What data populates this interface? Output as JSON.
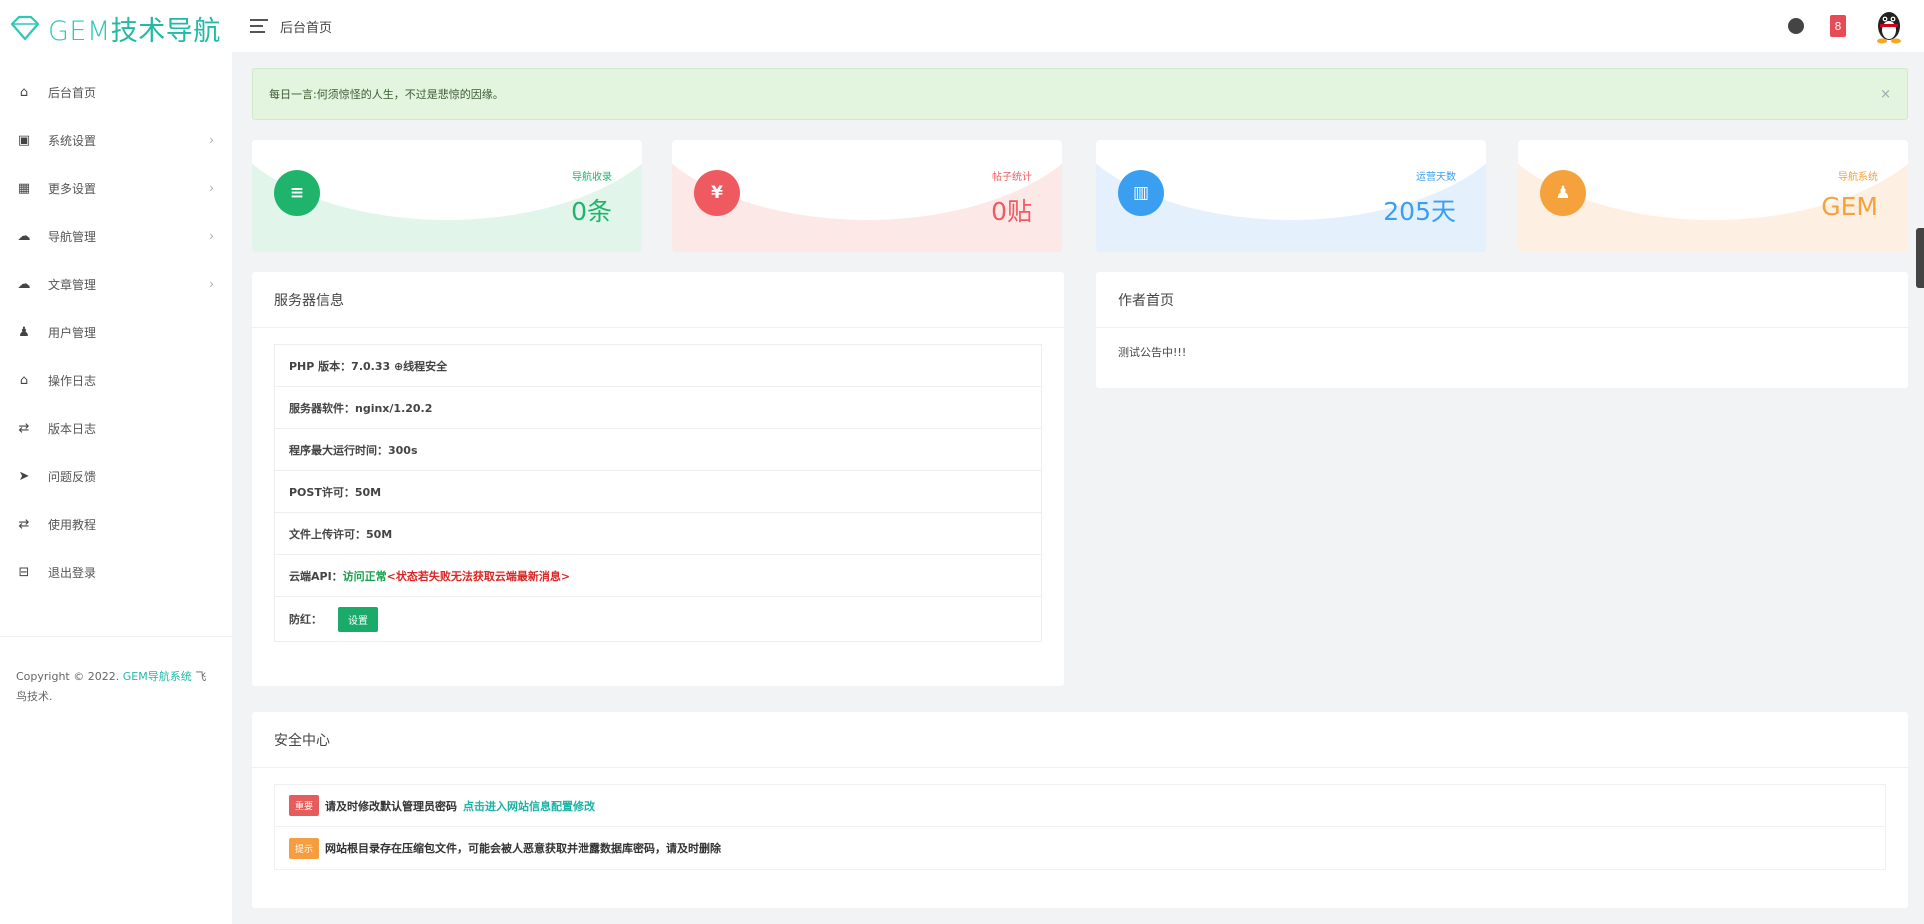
{
  "brand": {
    "prefix": "GEM",
    "suffix": "技术导航"
  },
  "sidebar": {
    "items": [
      {
        "icon": "home-icon",
        "glyph": "⌂",
        "label": "后台首页",
        "has_children": false
      },
      {
        "icon": "settings-icon",
        "glyph": "▣",
        "label": "系统设置",
        "has_children": true
      },
      {
        "icon": "grid-icon",
        "glyph": "▦",
        "label": "更多设置",
        "has_children": true
      },
      {
        "icon": "cloud-icon",
        "glyph": "☁",
        "label": "导航管理",
        "has_children": true
      },
      {
        "icon": "cloud-outline-icon",
        "glyph": "☁",
        "label": "文章管理",
        "has_children": true
      },
      {
        "icon": "user-icon",
        "glyph": "♟",
        "label": "用户管理",
        "has_children": false
      },
      {
        "icon": "log-icon",
        "glyph": "⌂",
        "label": "操作日志",
        "has_children": false
      },
      {
        "icon": "version-icon",
        "glyph": "⇄",
        "label": "版本日志",
        "has_children": false
      },
      {
        "icon": "send-icon",
        "glyph": "➤",
        "label": "问题反馈",
        "has_children": false
      },
      {
        "icon": "tutorial-icon",
        "glyph": "⇄",
        "label": "使用教程",
        "has_children": false
      },
      {
        "icon": "logout-icon",
        "glyph": "⊟",
        "label": "退出登录",
        "has_children": false
      }
    ],
    "copyright_prefix": "Copyright © 2022.",
    "copyright_link": "GEM导航系统",
    "copyright_suffix": "飞鸟技术."
  },
  "header": {
    "title": "后台首页",
    "badge": "8"
  },
  "notice": {
    "text": "每日一言:何须惊怪的人生，不过是悲惊的因缘。",
    "close": "×"
  },
  "stats": [
    {
      "label": "导航收录",
      "value": "0条",
      "glyph": "≡",
      "color": "#1fb46b",
      "bg": "#e2f5ea",
      "label_color": "#1fb46b",
      "value_color": "#1fb46b",
      "icon": "list-icon"
    },
    {
      "label": "帖子统计",
      "value": "0贴",
      "glyph": "¥",
      "color": "#ee5a5f",
      "bg": "#fde8e8",
      "label_color": "#ee5a5f",
      "value_color": "#ee5a5f",
      "icon": "yen-icon"
    },
    {
      "label": "运营天数",
      "value": "205天",
      "glyph": "▥",
      "color": "#3a9ff0",
      "bg": "#e4f1fc",
      "label_color": "#3a9ff0",
      "value_color": "#3a9ff0",
      "icon": "chart-icon"
    },
    {
      "label": "导航系统",
      "value": "GEM",
      "glyph": "♟",
      "color": "#f5a23d",
      "bg": "#fdf0e2",
      "label_color": "#f5a23d",
      "value_color": "#f5a23d",
      "icon": "person-icon"
    }
  ],
  "server": {
    "title": "服务器信息",
    "php": "PHP 版本：7.0.33 ⊕线程安全",
    "software": "服务器软件：nginx/1.20.2",
    "max_time": "程序最大运行时间：300s",
    "post": "POST许可：50M",
    "upload": "文件上传许可：50M",
    "api_label": "云端API：",
    "api_status": "访问正常",
    "api_note": "<状态若失败无法获取云端最新消息>",
    "toggle_label": "防红：",
    "toggle_button": "设置"
  },
  "author": {
    "title": "作者首页",
    "body": "测试公告中!!!"
  },
  "security": {
    "title": "安全中心",
    "rows": [
      {
        "tag": "重要",
        "text": "请及时修改默认管理员密码",
        "link": "点击进入网站信息配置修改"
      },
      {
        "tag": "提示",
        "text": "网站根目录存在压缩包文件，可能会被人恶意获取并泄露数据库密码，请及时删除",
        "link": ""
      }
    ]
  }
}
